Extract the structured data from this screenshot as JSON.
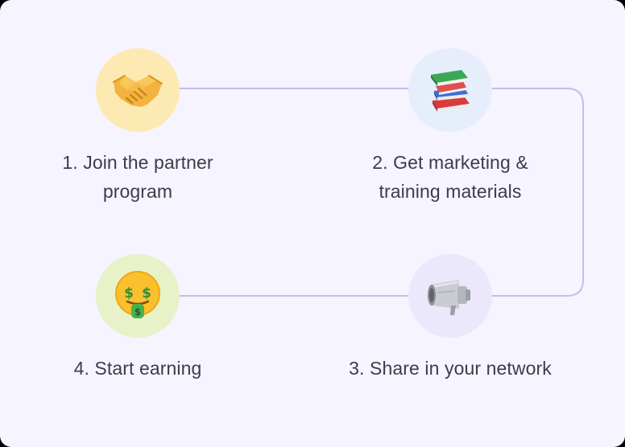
{
  "steps": [
    {
      "label": "1. Join the partner\nprogram",
      "icon": "handshake-icon",
      "circle_color": "#fdeab3"
    },
    {
      "label": "2. Get marketing &\ntraining materials",
      "icon": "books-icon",
      "circle_color": "#e6edfb"
    },
    {
      "label": "3. Share in your network",
      "icon": "megaphone-icon",
      "circle_color": "#ebe8fb"
    },
    {
      "label": "4. Start earning",
      "icon": "money-mouth-face-icon",
      "circle_color": "#e7f2c8"
    }
  ],
  "colors": {
    "background": "#f6f4ff",
    "connector": "#c6bcea",
    "text": "#3b3d48"
  }
}
